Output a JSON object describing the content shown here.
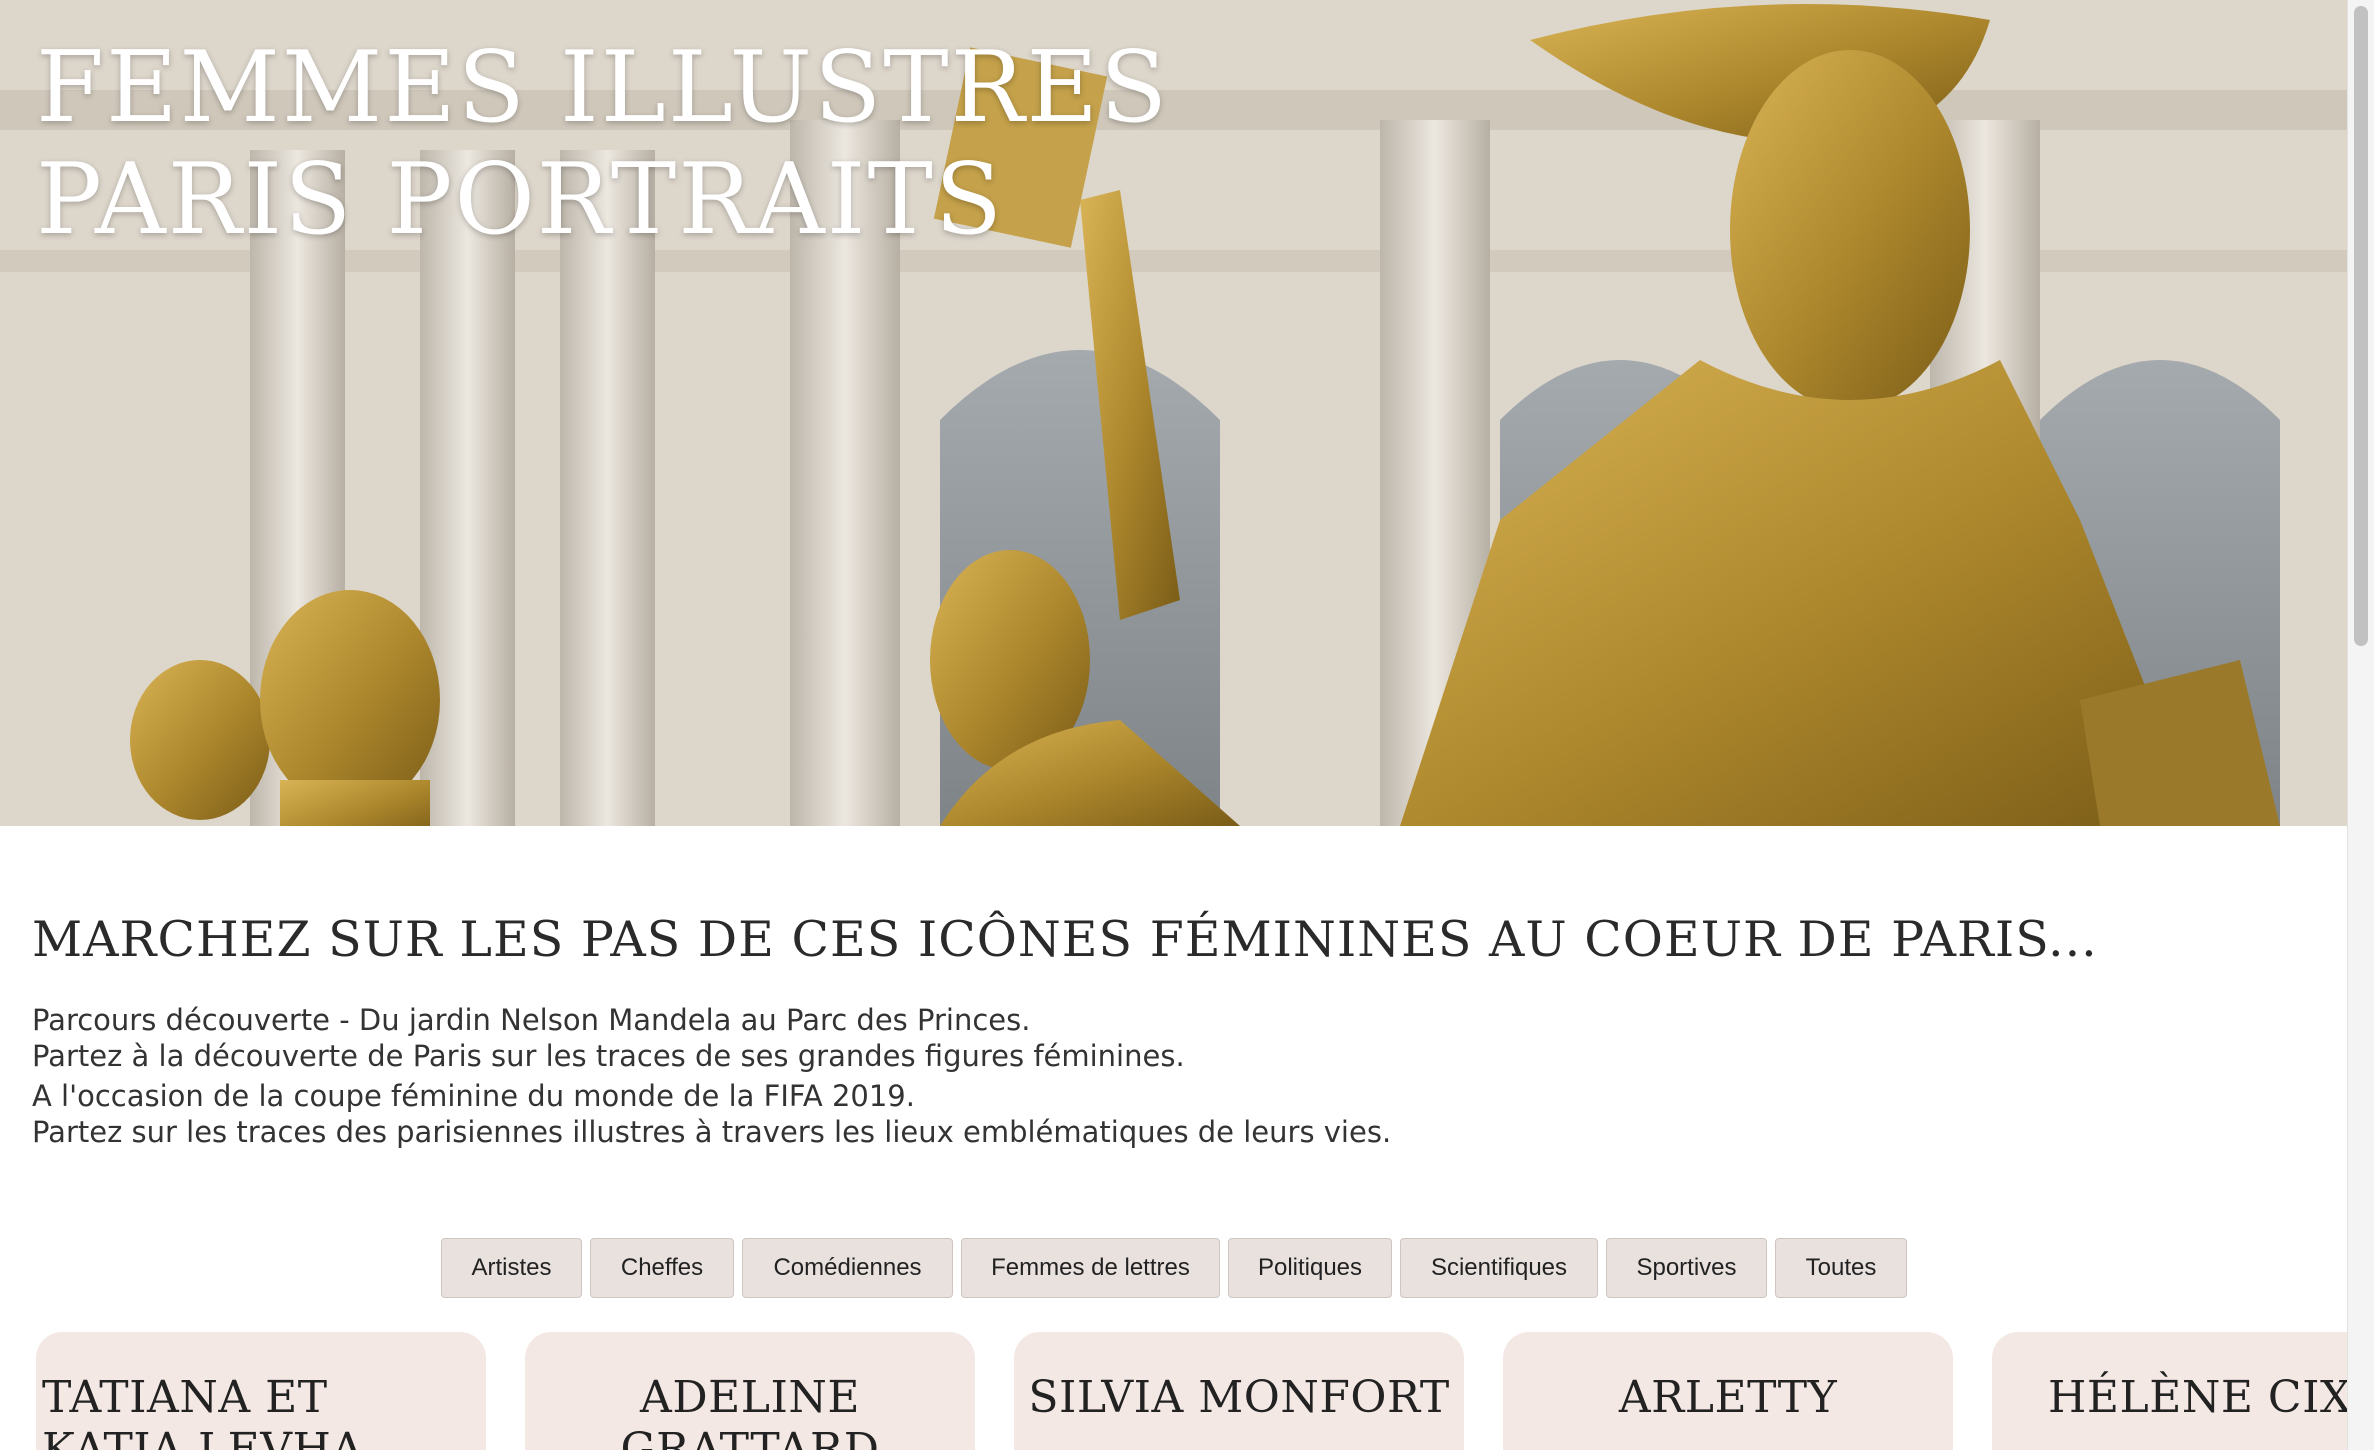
{
  "hero": {
    "title_line1": "FEMMES ILLUSTRES",
    "title_line2": "PARIS PORTRAITS"
  },
  "intro": {
    "heading": "MARCHEZ SUR LES PAS DE CES ICÔNES FÉMININES AU COEUR DE PARIS...",
    "lines": [
      "Parcours découverte - Du jardin Nelson Mandela au Parc des Princes.",
      "Partez à la découverte de Paris sur les traces de ses grandes figures féminines.",
      "A l'occasion de la coupe féminine du monde de la FIFA 2019.",
      "Partez sur les traces des parisiennes illustres à travers les lieux emblématiques de leurs vies."
    ]
  },
  "filters": [
    {
      "label": "Artistes"
    },
    {
      "label": "Cheffes"
    },
    {
      "label": "Comédiennes"
    },
    {
      "label": "Femmes de lettres"
    },
    {
      "label": "Politiques"
    },
    {
      "label": "Scientifiques"
    },
    {
      "label": "Sportives"
    },
    {
      "label": "Toutes"
    }
  ],
  "cards": [
    {
      "name": "TATIANA ET KATIA LEVHA"
    },
    {
      "name": "ADELINE GRATTARD"
    },
    {
      "name": "SILVIA MONFORT"
    },
    {
      "name": "ARLETTY"
    },
    {
      "name": "HÉLÈNE CIXOUS"
    }
  ],
  "colors": {
    "button_bg": "#e9e1de",
    "card_bg": "#f4e8e4",
    "statue_gold": "#b08a2e"
  }
}
